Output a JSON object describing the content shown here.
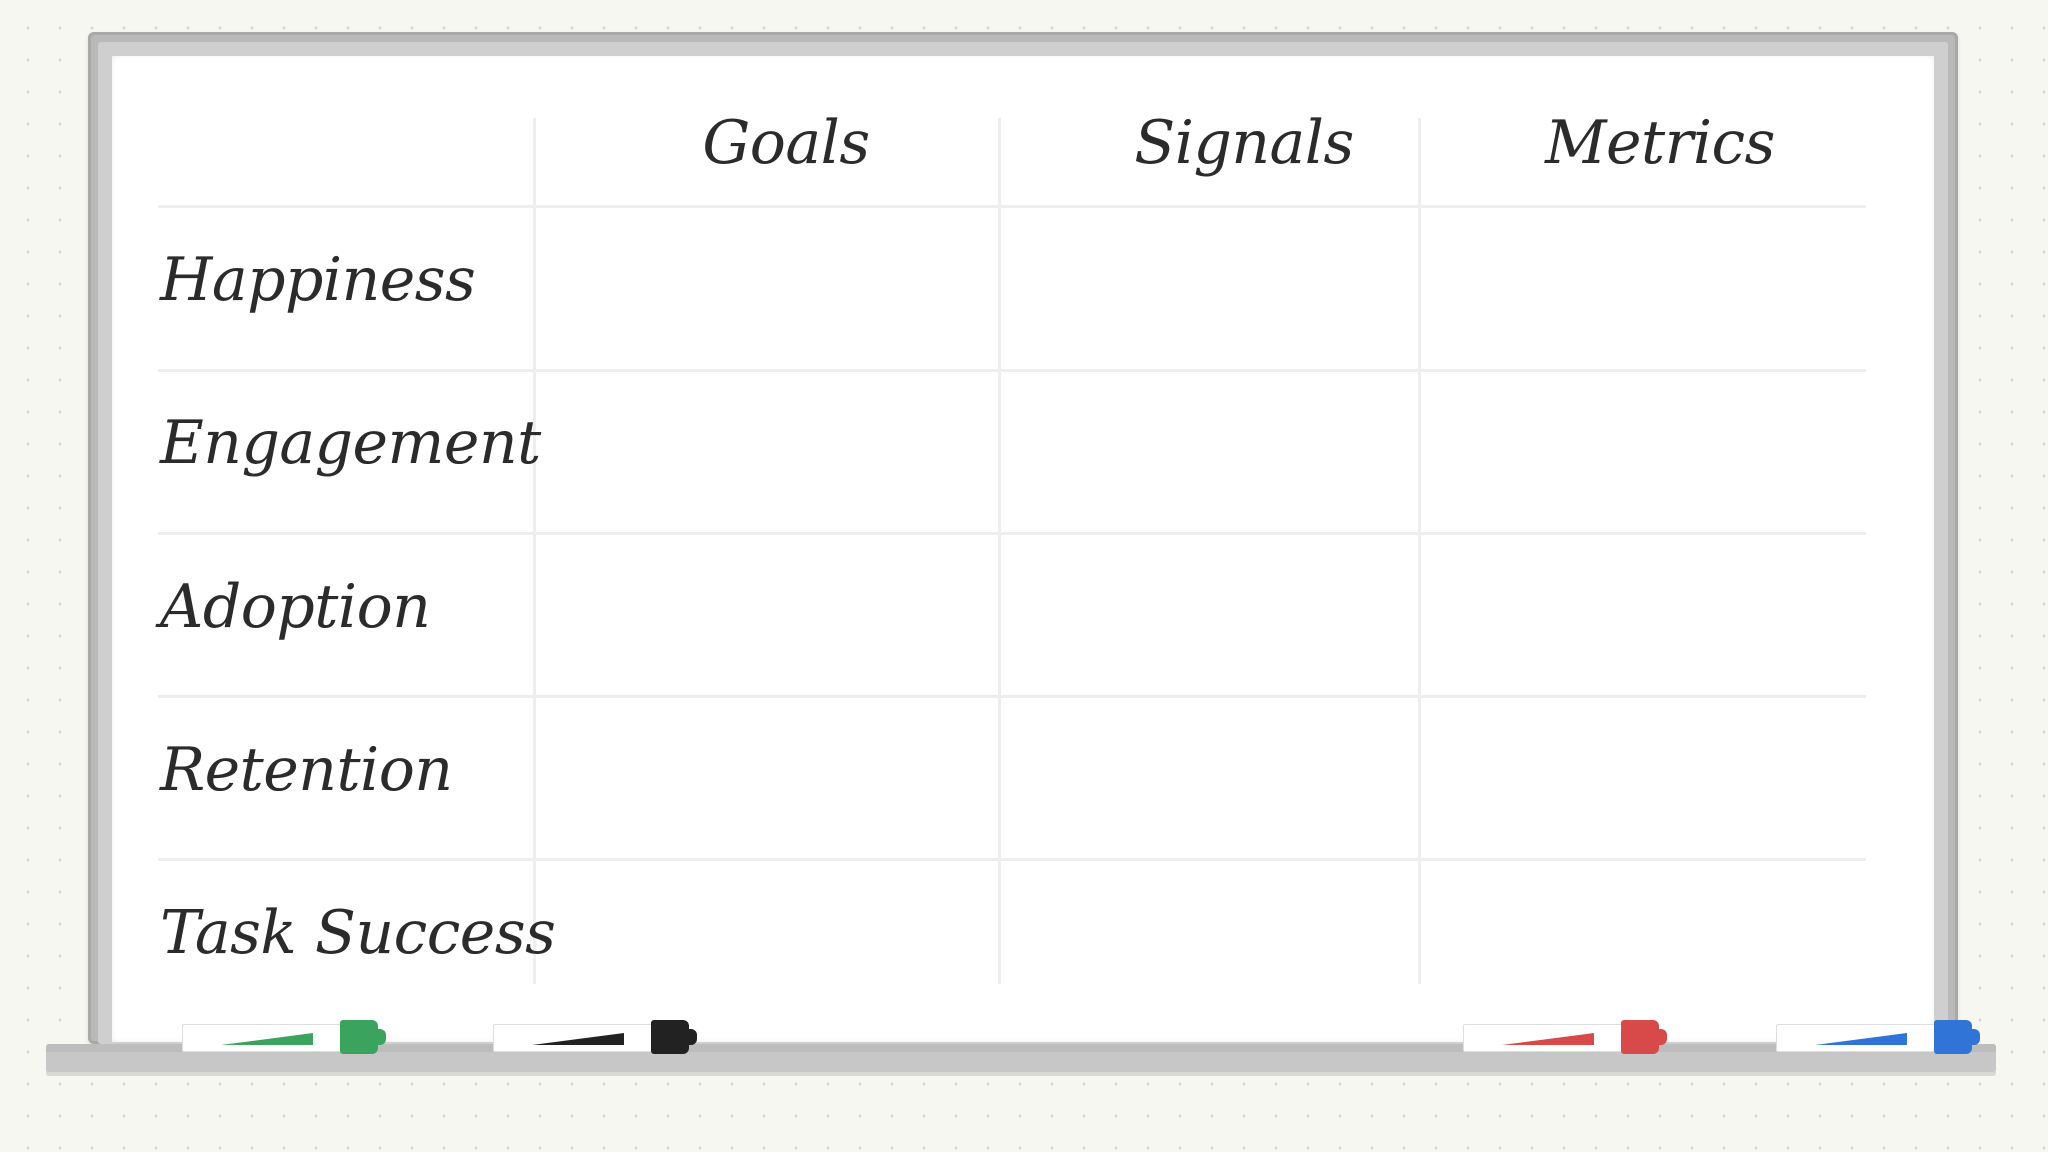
{
  "whiteboard": {
    "columns": [
      {
        "label": "Goals"
      },
      {
        "label": "Signals"
      },
      {
        "label": "Metrics"
      }
    ],
    "rows": [
      {
        "label": "Happiness"
      },
      {
        "label": "Engagement"
      },
      {
        "label": "Adoption"
      },
      {
        "label": "Retention"
      },
      {
        "label": "Task Success"
      }
    ]
  },
  "markers": [
    {
      "name": "green-marker-icon",
      "color": "#3aa35e"
    },
    {
      "name": "black-marker-icon",
      "color": "#222222"
    },
    {
      "name": "red-marker-icon",
      "color": "#d84a4a"
    },
    {
      "name": "blue-marker-icon",
      "color": "#2f74d6"
    }
  ]
}
